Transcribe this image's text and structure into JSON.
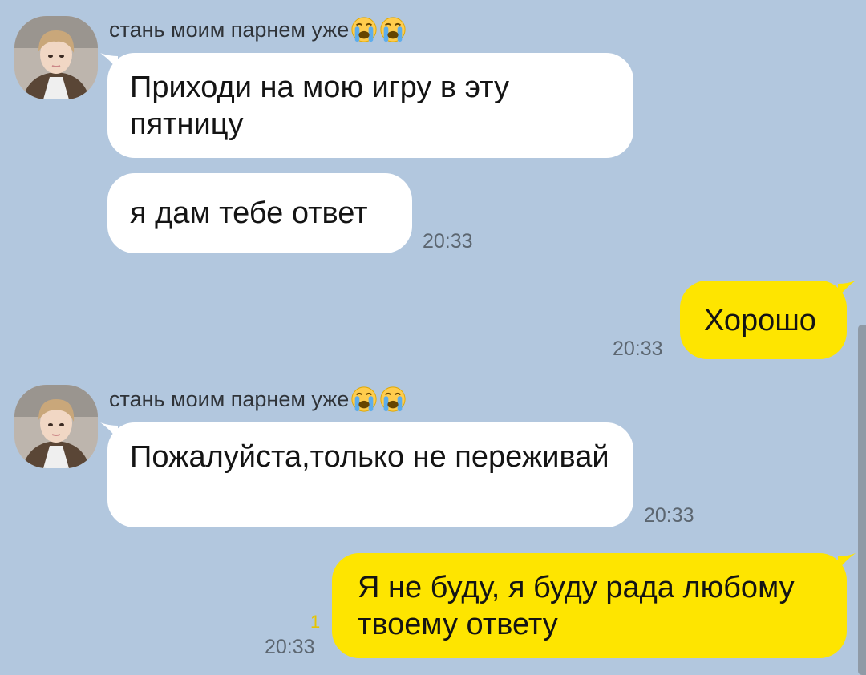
{
  "chat": {
    "sender_name": "стань моим парнем уже",
    "sender_emoji": [
      "loudly-crying-face",
      "loudly-crying-face"
    ],
    "colors": {
      "background": "#b2c7de",
      "incoming_bubble": "#ffffff",
      "outgoing_bubble": "#fee500",
      "time_text": "#5c6670",
      "unread_count": "#e6c400"
    },
    "groups": [
      {
        "messages": [
          {
            "text": "Приходи на мою игру в эту пятницу"
          },
          {
            "text": "я дам тебе ответ",
            "time": "20:33"
          }
        ]
      },
      {
        "messages": [
          {
            "text": "Пожалуйста,только не переживай",
            "time": "20:33"
          }
        ]
      }
    ],
    "outgoing": [
      {
        "text": "Хорошо",
        "time": "20:33"
      },
      {
        "text": "Я не буду, я буду рада любому твоему ответу",
        "time": "20:33",
        "unread": "1"
      }
    ]
  }
}
